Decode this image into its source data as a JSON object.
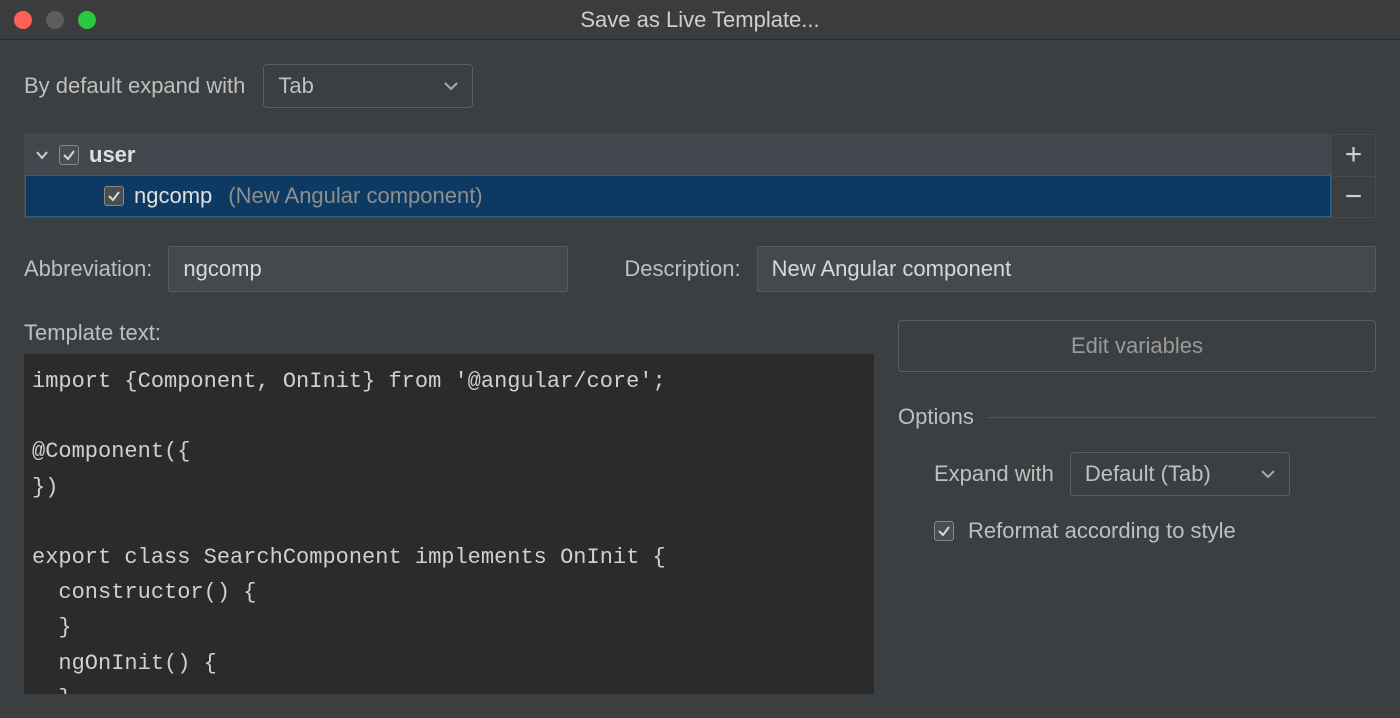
{
  "window": {
    "title": "Save as Live Template..."
  },
  "defaultExpand": {
    "label": "By default expand with",
    "value": "Tab"
  },
  "tree": {
    "group": {
      "name": "user",
      "checked": true,
      "expanded": true
    },
    "item": {
      "name": "ngcomp",
      "description": "(New Angular component)",
      "checked": true,
      "selected": true
    }
  },
  "form": {
    "abbrev_label": "Abbreviation:",
    "abbrev_value": "ngcomp",
    "desc_label": "Description:",
    "desc_value": "New Angular component"
  },
  "templateText": {
    "label": "Template text:",
    "code": "import {Component, OnInit} from '@angular/core';\n\n@Component({\n})\n\nexport class SearchComponent implements OnInit {\n  constructor() {\n  }\n  ngOnInit() {\n  }"
  },
  "editVariables": {
    "label": "Edit variables"
  },
  "options": {
    "title": "Options",
    "expand_label": "Expand with",
    "expand_value": "Default (Tab)",
    "reformat_label": "Reformat according to style",
    "reformat_checked": true
  }
}
